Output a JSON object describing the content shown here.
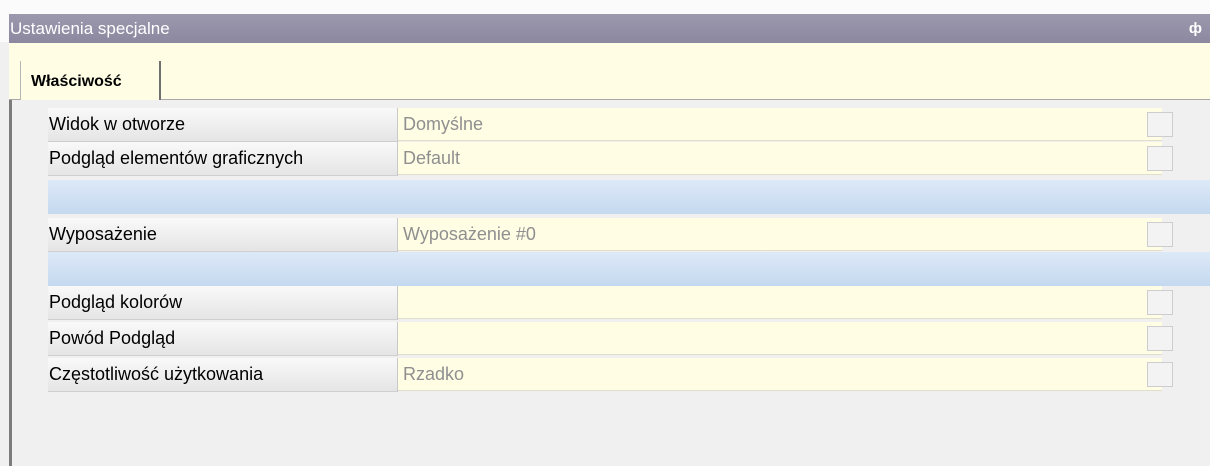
{
  "panel": {
    "title": "Ustawienia specjalne",
    "pin_glyph": "ф",
    "pin_icon": "pin-icon"
  },
  "tab": {
    "label": "Właściwość"
  },
  "properties": [
    {
      "label": "Widok w otworze",
      "value": "Domyślne"
    },
    {
      "label": "Podgląd elementów graficznych",
      "value": "Default"
    },
    {
      "label": "Wyposażenie",
      "value": "Wyposażenie #0"
    },
    {
      "label": "Podgląd kolorów",
      "value": ""
    },
    {
      "label": "Powód Podgląd",
      "value": ""
    },
    {
      "label": "Częstotliwość użytkowania",
      "value": "Rzadko"
    }
  ],
  "colors": {
    "titlebar": "#9591a7",
    "value_bg": "#fffde4",
    "category_band": "#cfe0f3"
  }
}
